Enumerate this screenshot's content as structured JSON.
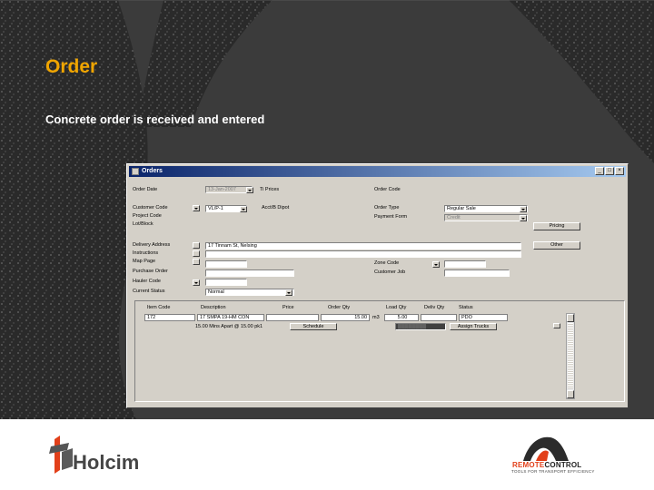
{
  "slide": {
    "title": "Order",
    "subtitle": "Concrete order is received and entered",
    "title_color": "#f0a500",
    "background_color": "#3b3b3b"
  },
  "footer": {
    "left_logo": {
      "icon": "holcim-logo-icon",
      "text": "Holcim"
    },
    "right_logo": {
      "icon": "remote-control-logo-icon",
      "text_a": "REMOTE",
      "text_b": "CONTROL",
      "tagline": "TOOLS FOR TRANSPORT EFFICIENCY"
    }
  },
  "window": {
    "title": "Orders",
    "title_controls": [
      "minimize",
      "maximize",
      "close"
    ],
    "header": {
      "order_date_label": "Order Date",
      "order_date_value": "13-Jan-2007",
      "time_label": "Ti Prices",
      "order_code_label": "Order Code"
    },
    "left": {
      "customer_code_label": "Customer Code",
      "customer_code_value": "VL/P-1",
      "project_code_label": "Project Code",
      "lot_block_label": "Lot/Block",
      "delivery_address_label": "Delivery Address",
      "delivery_address_value": "17 Tinnam St, Nelsing",
      "instructions_label": "Instructions",
      "map_page_label": "Map Page",
      "purchase_order_label": "Purchase Order",
      "hauler_code_label": "Hauler Code",
      "current_status_label": "Current Status",
      "current_status_value": "Normal"
    },
    "middle": {
      "acct_label": "Acct/B Dipot"
    },
    "right": {
      "order_type_label": "Order Type",
      "order_type_value": "Regular Sale",
      "payment_form_label": "Payment Form",
      "payment_form_value": "Credit",
      "zone_code_label": "Zone Code",
      "customer_job_label": "Customer Job",
      "pricing_button": "Pricing",
      "other_button": "Other"
    },
    "grid": {
      "headers": [
        "Item Code",
        "Description",
        "Price",
        "Order Qty",
        "Load Qty",
        "Deliv Qty",
        "Status"
      ],
      "row": {
        "item_code": "172",
        "description": "17 SMPA 19-HM CON",
        "price": "",
        "order_qty": "15.00",
        "unit": "m3",
        "load_qty": "5.00",
        "deliv_qty": "",
        "status": "PDO"
      },
      "schedule_text": "15.00 Mins Apart @ 15.00 pk1",
      "schedule_button": "Schedule",
      "status_box": "▒▒▒▒▒▒▒▒",
      "assign_button": "Assign Trucks"
    }
  }
}
